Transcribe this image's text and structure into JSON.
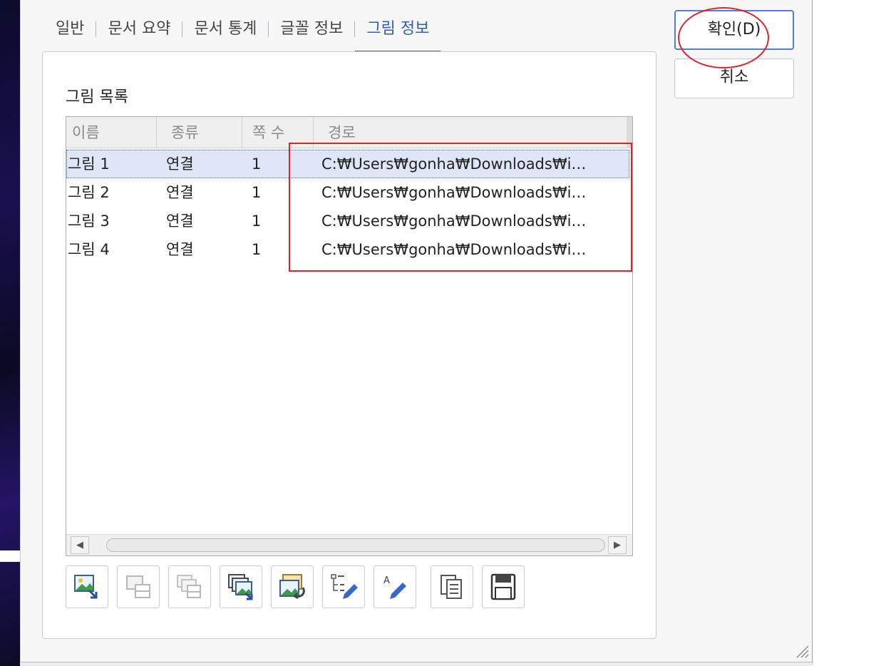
{
  "tabs": [
    {
      "label": "일반"
    },
    {
      "label": "문서 요약"
    },
    {
      "label": "문서 통계"
    },
    {
      "label": "글꼴 정보"
    },
    {
      "label": "그림 정보",
      "active": true
    }
  ],
  "section_title": "그림 목록",
  "table": {
    "columns": [
      "이름",
      "종류",
      "쪽 수",
      "경로"
    ],
    "rows": [
      {
        "name": "그림 1",
        "type": "연결",
        "page": "1",
        "path": "C:₩Users₩gonha₩Downloads₩i…",
        "selected": true
      },
      {
        "name": "그림 2",
        "type": "연결",
        "page": "1",
        "path": "C:₩Users₩gonha₩Downloads₩i…"
      },
      {
        "name": "그림 3",
        "type": "연결",
        "page": "1",
        "path": "C:₩Users₩gonha₩Downloads₩i…"
      },
      {
        "name": "그림 4",
        "type": "연결",
        "page": "1",
        "path": "C:₩Users₩gonha₩Downloads₩i…"
      }
    ]
  },
  "toolbar_icons": [
    {
      "icon": "insert-picture-icon",
      "enabled": true
    },
    {
      "icon": "picture-to-frame-icon",
      "enabled": false
    },
    {
      "icon": "copy-frame-icon",
      "enabled": false
    },
    {
      "icon": "save-pictures-icon",
      "enabled": true
    },
    {
      "icon": "replace-picture-icon",
      "enabled": true
    },
    {
      "icon": "edit-list-icon",
      "enabled": true
    },
    {
      "icon": "edit-text-icon",
      "enabled": true
    },
    {
      "icon": "copy-icon",
      "enabled": true
    },
    {
      "icon": "save-icon",
      "enabled": true
    }
  ],
  "buttons": {
    "ok": "확인(D)",
    "cancel": "취소"
  },
  "colors": {
    "accent": "#3f6ed0",
    "annotation": "#e0222b",
    "selection": "#dfe6f8"
  }
}
